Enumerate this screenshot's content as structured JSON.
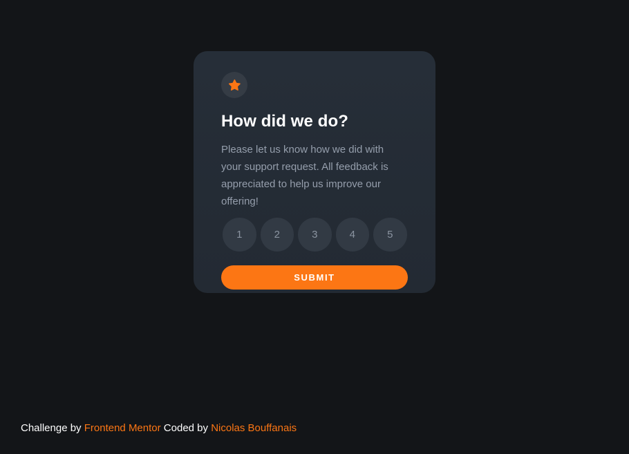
{
  "card": {
    "icon": "star-icon",
    "title": "How did we do?",
    "description": "Please let us know how we did with your support request. All feedback is appreciated to help us improve our offering!",
    "ratings": [
      "1",
      "2",
      "3",
      "4",
      "5"
    ],
    "submit_label": "SUBMIT"
  },
  "attribution": {
    "challenge_prefix": "Challenge by",
    "challenge_link": "Frontend Mentor",
    "coded_prefix": "Coded by",
    "coded_link": "Nicolas Bouffanais"
  },
  "colors": {
    "background": "#131518",
    "card": "#252d37",
    "accent": "#fc7614",
    "muted_text": "#959eac",
    "rating_bg": "#323a44"
  }
}
